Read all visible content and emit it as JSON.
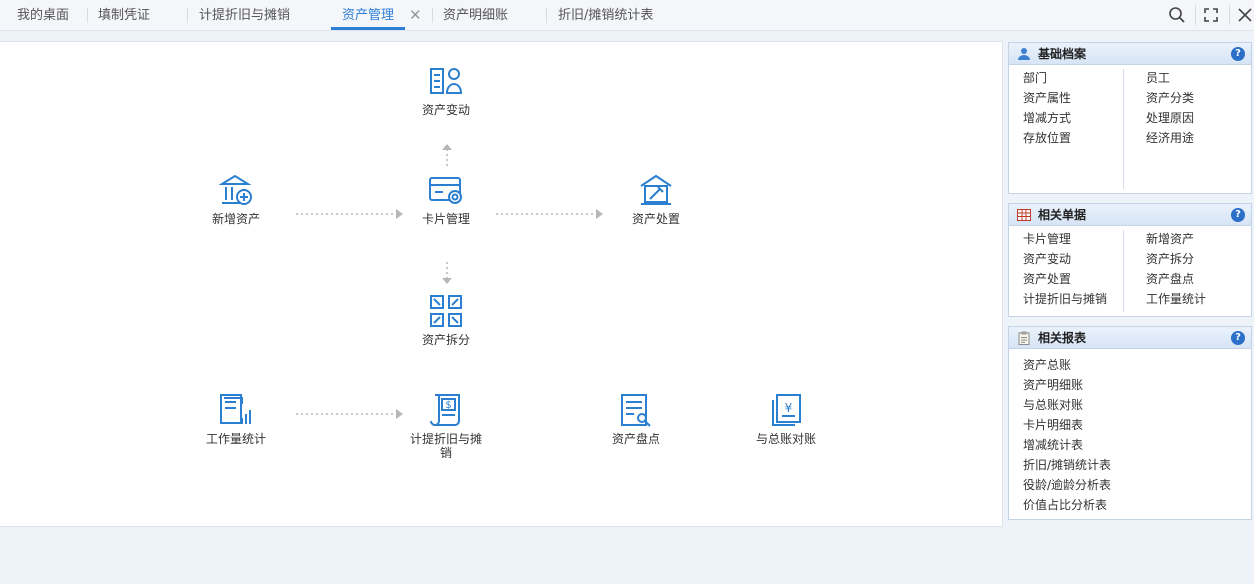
{
  "tabs": [
    {
      "label": "我的桌面"
    },
    {
      "label": "填制凭证"
    },
    {
      "label": "计提折旧与摊销"
    },
    {
      "label": "资产管理"
    },
    {
      "label": "资产明细账"
    },
    {
      "label": "折旧/摊销统计表"
    }
  ],
  "active_tab": "资产管理",
  "tab_close_glyph": "✕",
  "toolbar": {
    "icons": [
      "search-icon",
      "fullscreen-icon",
      "close-icon"
    ]
  },
  "flow": {
    "asset_change": "资产变动",
    "new_asset": "新增资产",
    "card_management": "卡片管理",
    "asset_disposal": "资产处置",
    "asset_split": "资产拆分",
    "workload_stats": "工作量统计",
    "depreciation_line1": "计提折旧与摊",
    "depreciation_line2": "销",
    "asset_inventory": "资产盘点",
    "reconcile_ledger": "与总账对账"
  },
  "panels": {
    "basic_files": {
      "title": "基础档案",
      "left": [
        "部门",
        "资产属性",
        "增减方式",
        "存放位置"
      ],
      "right": [
        "员工",
        "资产分类",
        "处理原因",
        "经济用途"
      ]
    },
    "related_docs": {
      "title": "相关单据",
      "left": [
        "卡片管理",
        "资产变动",
        "资产处置",
        "计提折旧与摊销"
      ],
      "right": [
        "新增资产",
        "资产拆分",
        "资产盘点",
        "工作量统计"
      ]
    },
    "related_reports": {
      "title": "相关报表",
      "items": [
        "资产总账",
        "资产明细账",
        "与总账对账",
        "卡片明细表",
        "增减统计表",
        "折旧/摊销统计表",
        "役龄/逾龄分析表",
        "价值占比分析表"
      ]
    }
  },
  "help_glyph": "?",
  "colors": {
    "accent": "#2f7fd6",
    "icon": "#2b7fd0",
    "arrow": "#b7b7b7"
  }
}
